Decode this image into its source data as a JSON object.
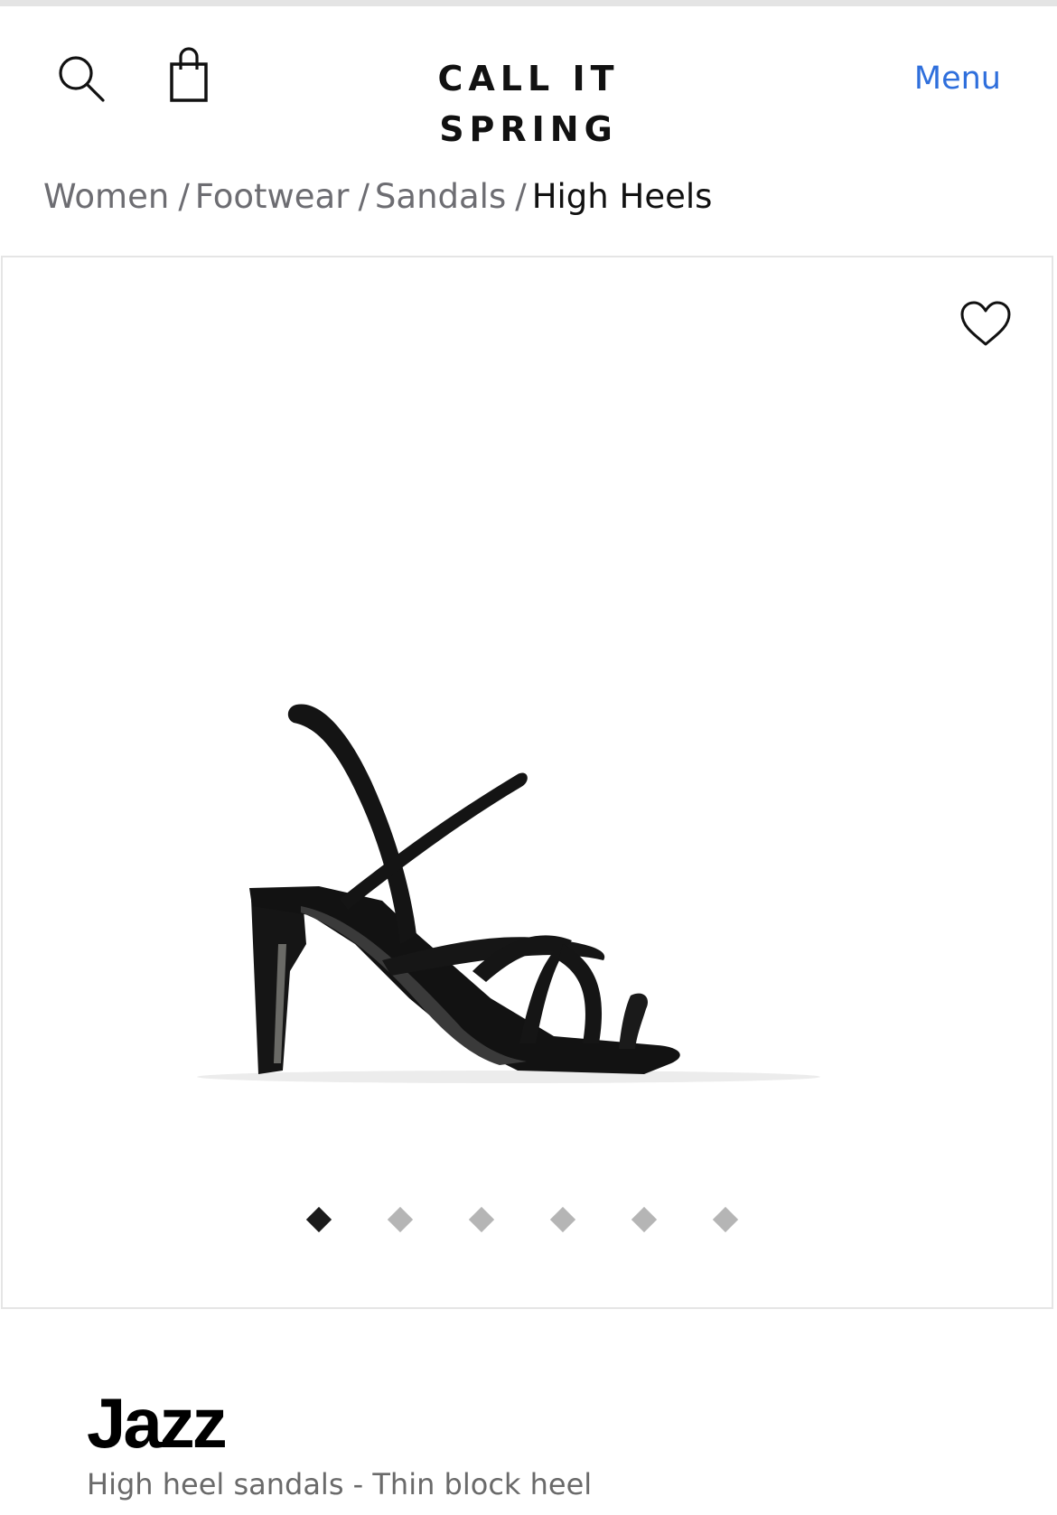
{
  "colors": {
    "accent": "#2f6fdc",
    "text": "#111111",
    "muted": "#6d6d72",
    "dot_active": "#1b1b1b",
    "dot_inactive": "#b5b5b5"
  },
  "header": {
    "search_icon": "search-icon",
    "bag_icon": "shopping-bag-icon",
    "brand": "CALL IT SPRING",
    "menu_label": "Menu"
  },
  "breadcrumb": {
    "items": [
      "Women",
      "Footwear",
      "Sandals"
    ],
    "separator": "/",
    "current": "High Heels"
  },
  "gallery": {
    "wishlist_icon": "heart-outline-icon",
    "image_subject": "black strappy high heel sandal",
    "total_images": 6,
    "active_index": 0
  },
  "product": {
    "name": "Jazz",
    "description": "High heel sandals - Thin block heel"
  }
}
